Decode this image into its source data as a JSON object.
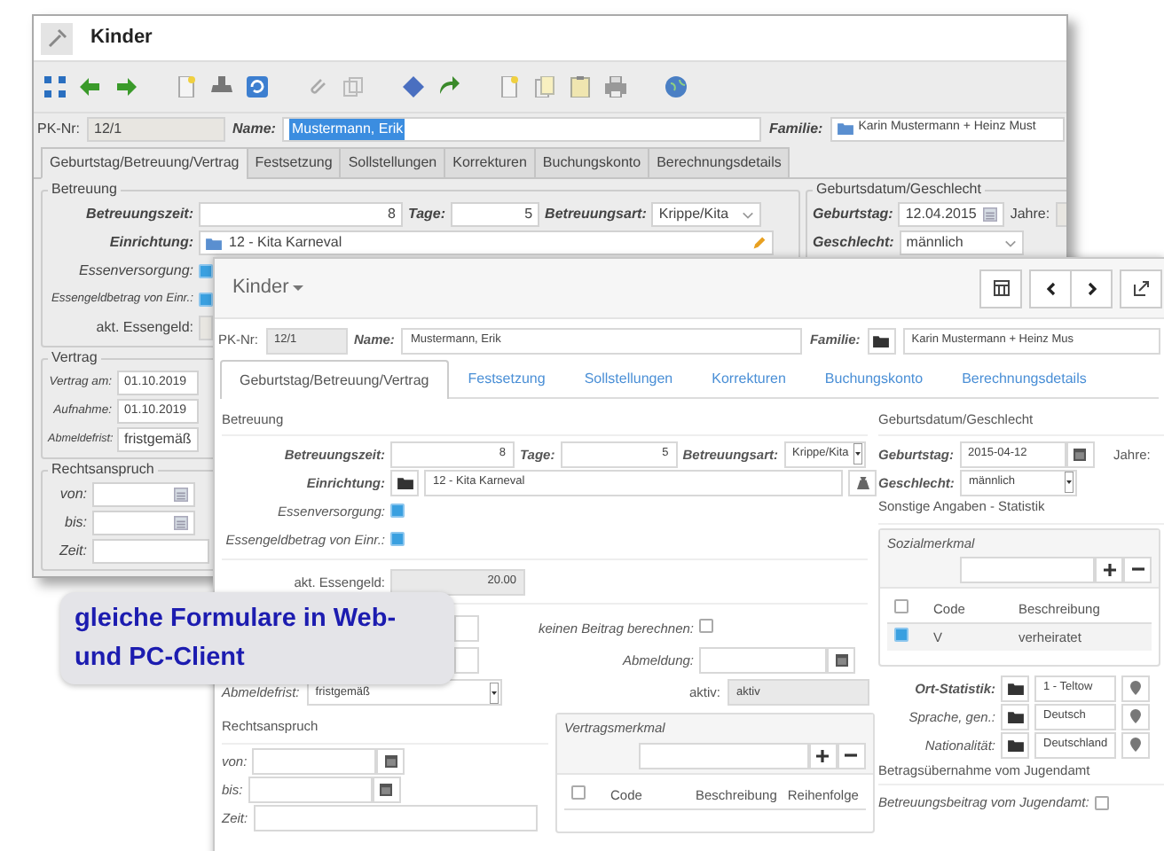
{
  "desktop_client": {
    "title": "Kinder",
    "pk": {
      "label": "PK-Nr:",
      "value": "12/1"
    },
    "name": {
      "label": "Name:",
      "value": "Mustermann, Erik",
      "selected": true
    },
    "familie": {
      "label": "Familie:",
      "value": "Karin Mustermann + Heinz Must"
    },
    "tabs": [
      {
        "label": "Geburtstag/Betreuung/Vertrag",
        "selected": true
      },
      {
        "label": "Festsetzung",
        "selected": false
      },
      {
        "label": "Sollstellungen",
        "selected": false
      },
      {
        "label": "Korrekturen",
        "selected": false
      },
      {
        "label": "Buchungskonto",
        "selected": false
      },
      {
        "label": "Berechnungsdetails",
        "selected": false
      }
    ],
    "betreuung": {
      "legend": "Betreuung",
      "betreuungszeit": {
        "label": "Betreuungszeit:",
        "value": "8"
      },
      "tage": {
        "label": "Tage:",
        "value": "5"
      },
      "betreuungsart": {
        "label": "Betreuungsart:",
        "value": "Krippe/Kita"
      },
      "einrichtung": {
        "label": "Einrichtung:",
        "value": "12 - Kita Karneval"
      },
      "essenversorgung": {
        "label": "Essenversorgung:",
        "checked": true
      },
      "essengeldbetrag": {
        "label": "Essengeldbetrag von Einr.:",
        "checked": true
      },
      "akt_essengeld": {
        "label": "akt. Essengeld:"
      }
    },
    "geburtsdatum": {
      "legend": "Geburtsdatum/Geschlecht",
      "geburtstag": {
        "label": "Geburtstag:",
        "value": "12.04.2015"
      },
      "jahre": {
        "label": "Jahre:"
      },
      "geschlecht": {
        "label": "Geschlecht:",
        "value": "männlich"
      }
    },
    "vertrag": {
      "legend": "Vertrag",
      "vertrag_am": {
        "label": "Vertrag am:",
        "value": "01.10.2019"
      },
      "aufnahme": {
        "label": "Aufnahme:",
        "value": "01.10.2019"
      },
      "abmeldefrist": {
        "label": "Abmeldefrist:",
        "value": "fristgemäß"
      }
    },
    "rechtsanspruch": {
      "legend": "Rechtsanspruch",
      "von": {
        "label": "von:"
      },
      "bis": {
        "label": "bis:"
      },
      "zeit": {
        "label": "Zeit:"
      }
    }
  },
  "web_client": {
    "title": "Kinder",
    "pk": {
      "label": "PK-Nr:",
      "value": "12/1"
    },
    "name": {
      "label": "Name:",
      "value": "Mustermann, Erik"
    },
    "familie": {
      "label": "Familie:",
      "value": "Karin Mustermann + Heinz Mus"
    },
    "tabs": [
      {
        "label": "Geburtstag/Betreuung/Vertrag",
        "selected": true
      },
      {
        "label": "Festsetzung",
        "selected": false
      },
      {
        "label": "Sollstellungen",
        "selected": false
      },
      {
        "label": "Korrekturen",
        "selected": false
      },
      {
        "label": "Buchungskonto",
        "selected": false
      },
      {
        "label": "Berechnungsdetails",
        "selected": false
      }
    ],
    "betreuung": {
      "legend": "Betreuung",
      "betreuungszeit": {
        "label": "Betreuungszeit:",
        "value": "8"
      },
      "tage": {
        "label": "Tage:",
        "value": "5"
      },
      "betreuungsart": {
        "label": "Betreuungsart:",
        "value": "Krippe/Kita"
      },
      "einrichtung": {
        "label": "Einrichtung:",
        "value": "12 - Kita Karneval"
      },
      "essenversorgung": {
        "label": "Essenversorgung:",
        "checked": true
      },
      "essengeldbetrag": {
        "label": "Essengeldbetrag von Einr.:",
        "checked": true
      },
      "akt_essengeld": {
        "label": "akt. Essengeld:",
        "value": "20.00"
      }
    },
    "vertrag": {
      "keinen_beitrag": {
        "label": "keinen Beitrag berechnen:",
        "checked": false
      },
      "abmeldung": {
        "label": "Abmeldung:"
      },
      "abmeldefrist": {
        "label": "Abmeldefrist:",
        "value": "fristgemäß"
      },
      "aktiv": {
        "label": "aktiv:",
        "value": "aktiv"
      }
    },
    "rechtsanspruch": {
      "legend": "Rechtsanspruch",
      "von": {
        "label": "von:"
      },
      "bis": {
        "label": "bis:"
      },
      "zeit": {
        "label": "Zeit:"
      }
    },
    "vertragsmerkmal": {
      "title": "Vertragsmerkmal",
      "all_checked": false,
      "columns": [
        "Code",
        "Beschreibung",
        "Reihenfolge"
      ]
    },
    "geburtsdatum": {
      "legend": "Geburtsdatum/Geschlecht",
      "geburtstag": {
        "label": "Geburtstag:",
        "value": "2015-04-12"
      },
      "jahre": {
        "label": "Jahre:"
      },
      "geschlecht": {
        "label": "Geschlecht:",
        "value": "männlich"
      }
    },
    "statistik": {
      "legend": "Sonstige Angaben - Statistik",
      "sozialmerkmal": {
        "title": "Sozialmerkmal",
        "all_checked": false,
        "columns": [
          "Code",
          "Beschreibung"
        ],
        "rows": [
          {
            "code": "V",
            "beschreibung": "verheiratet",
            "checked": true
          }
        ]
      },
      "ort": {
        "label": "Ort-Statistik:",
        "value": "1 - Teltow"
      },
      "sprache": {
        "label": "Sprache, gen.:",
        "value": "Deutsch"
      },
      "nationalitaet": {
        "label": "Nationalität:",
        "value": "Deutschland"
      }
    },
    "jugendamt": {
      "legend": "Betragsübernahme vom Jugendamt",
      "betreuungsbeitrag": {
        "label": "Betreuungsbeitrag vom Jugendamt:",
        "checked": false
      }
    }
  },
  "callout": {
    "text": "gleiche Formulare in Web- und PC-Client"
  }
}
